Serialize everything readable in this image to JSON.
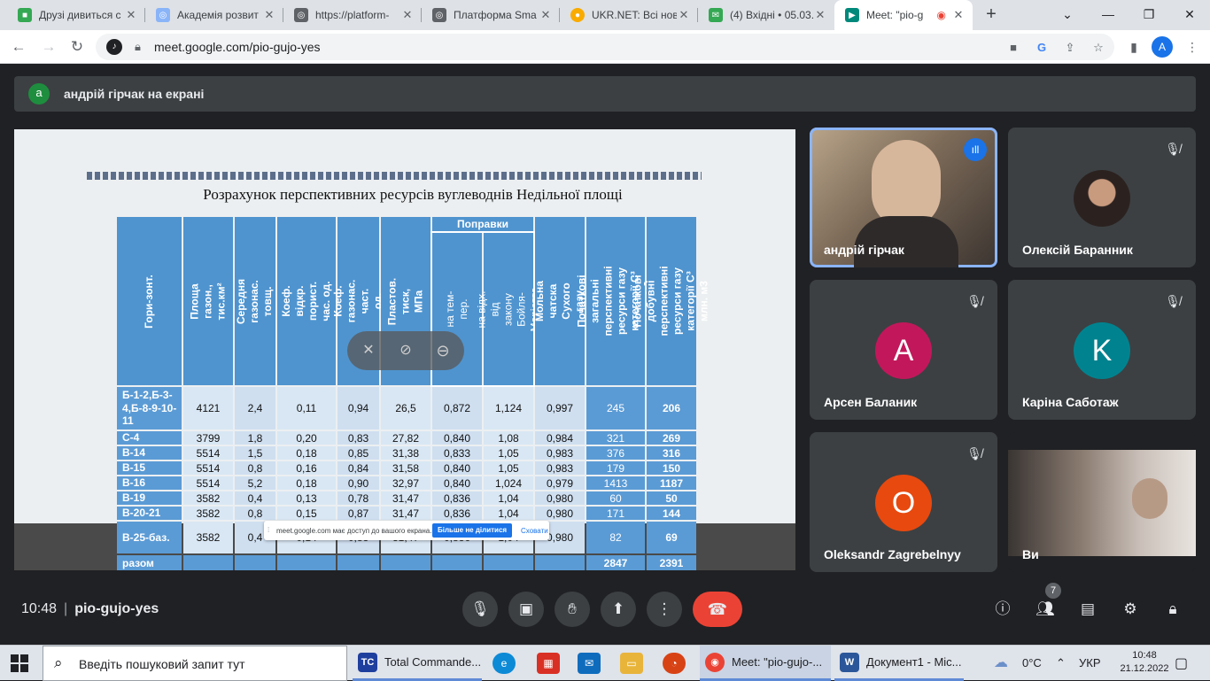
{
  "browser": {
    "tabs": [
      {
        "title": "Друзі дивиться с",
        "favicon_icon": "green-square-icon",
        "favicon_color": "#34a853"
      },
      {
        "title": "Академія розвит",
        "favicon_icon": "globe-icon",
        "favicon_color": "#5f6368"
      },
      {
        "title": "https://platform-",
        "favicon_icon": "globe-icon",
        "favicon_color": "#5f6368"
      },
      {
        "title": "Платформа Sma",
        "favicon_icon": "globe-icon",
        "favicon_color": "#5f6368"
      },
      {
        "title": "UKR.NET: Всі нов",
        "favicon_icon": "ukrnet-icon",
        "favicon_color": "#f9ab00"
      },
      {
        "title": "(4) Вхідні • 05.03.",
        "favicon_icon": "mail-icon",
        "favicon_color": "#34a853"
      },
      {
        "title": "Meet: \"pio-g",
        "favicon_icon": "meet-icon",
        "favicon_color": "#00897b"
      }
    ],
    "url": "meet.google.com/pio-gujo-yes",
    "profile_initial": "A"
  },
  "presenter_bar": {
    "avatar_initial": "а",
    "text": "андрій гірчак на екрані"
  },
  "slide": {
    "title": "Розрахунок перспективних ресурсів вуглеводнів Недільної площі",
    "group_header": "Поправки",
    "headers": [
      "Гори-зонт.",
      "Площа газон., тис.км²",
      "Середня газонас. товщ.",
      "Коеф. відкр. порист. час. од.",
      "Коеф. газонас. част. од.",
      "Пластов. тиск, МПа",
      "на тем-пер.",
      "на відх. від закону Бойля-Маріотта",
      "Мольна чатска Сухого газу",
      "Початкові загальні перспективні ресурси газу категорії С³ млн. м3",
      "Початкові добувні перспективні ресурси газу категорії С³ млн. м3"
    ],
    "rows": [
      [
        "Б-1-2,Б-3-4,Б-8-9-10-11",
        "4121",
        "2,4",
        "0,11",
        "0,94",
        "26,5",
        "0,872",
        "1,124",
        "0,997",
        "245",
        "206"
      ],
      [
        "С-4",
        "3799",
        "1,8",
        "0,20",
        "0,83",
        "27,82",
        "0,840",
        "1,08",
        "0,984",
        "321",
        "269"
      ],
      [
        "В-14",
        "5514",
        "1,5",
        "0,18",
        "0,85",
        "31,38",
        "0,833",
        "1,05",
        "0,983",
        "376",
        "316"
      ],
      [
        "В-15",
        "5514",
        "0,8",
        "0,16",
        "0,84",
        "31,58",
        "0,840",
        "1,05",
        "0,983",
        "179",
        "150"
      ],
      [
        "В-16",
        "5514",
        "5,2",
        "0,18",
        "0,90",
        "32,97",
        "0,840",
        "1,024",
        "0,979",
        "1413",
        "1187"
      ],
      [
        "В-19",
        "3582",
        "0,4",
        "0,13",
        "0,78",
        "31,47",
        "0,836",
        "1,04",
        "0,980",
        "60",
        "50"
      ],
      [
        "В-20-21",
        "3582",
        "0,8",
        "0,15",
        "0,87",
        "31,47",
        "0,836",
        "1,04",
        "0,980",
        "171",
        "144"
      ],
      [
        "В-25-баз.",
        "3582",
        "0,4",
        "0,14",
        "0,83",
        "31,47",
        "0,836",
        "1,04",
        "0,980",
        "82",
        "69"
      ]
    ],
    "total_row": [
      "разом",
      "",
      "",
      "",
      "",
      "",
      "",
      "",
      "",
      "2847",
      "2391"
    ]
  },
  "share_popup": {
    "message": "meet.google.com має доступ до вашого екрана.",
    "stop_label": "Більше не ділитися",
    "hide_label": "Сховати"
  },
  "participants": [
    {
      "name": "андрій гірчак",
      "type": "video",
      "speaking": true
    },
    {
      "name": "Олексій Баранник",
      "type": "photo",
      "muted": true
    },
    {
      "name": "Арсен Баланик",
      "initial": "A",
      "color": "#c2185b",
      "muted": true
    },
    {
      "name": "Каріна Саботаж",
      "initial": "K",
      "color": "#00838f",
      "muted": true
    },
    {
      "name": "Oleksandr Zagrebelnyy",
      "initial": "O",
      "color": "#e8490f",
      "muted": true
    },
    {
      "name": "Ви",
      "type": "video"
    }
  ],
  "meeting": {
    "time": "10:48",
    "code": "pio-gujo-yes",
    "people_count": "7"
  },
  "taskbar": {
    "search_placeholder": "Введіть пошуковий запит тут",
    "apps": [
      {
        "label": "Total Commande...",
        "color": "#1f3f9e"
      },
      {
        "label": "Meet: \"pio-gujo-...",
        "color": "#ea4335"
      },
      {
        "label": "Документ1 - Mic...",
        "color": "#2b579a"
      }
    ],
    "temperature": "0°C",
    "language": "УКР",
    "time": "10:48",
    "date": "21.12.2022"
  }
}
